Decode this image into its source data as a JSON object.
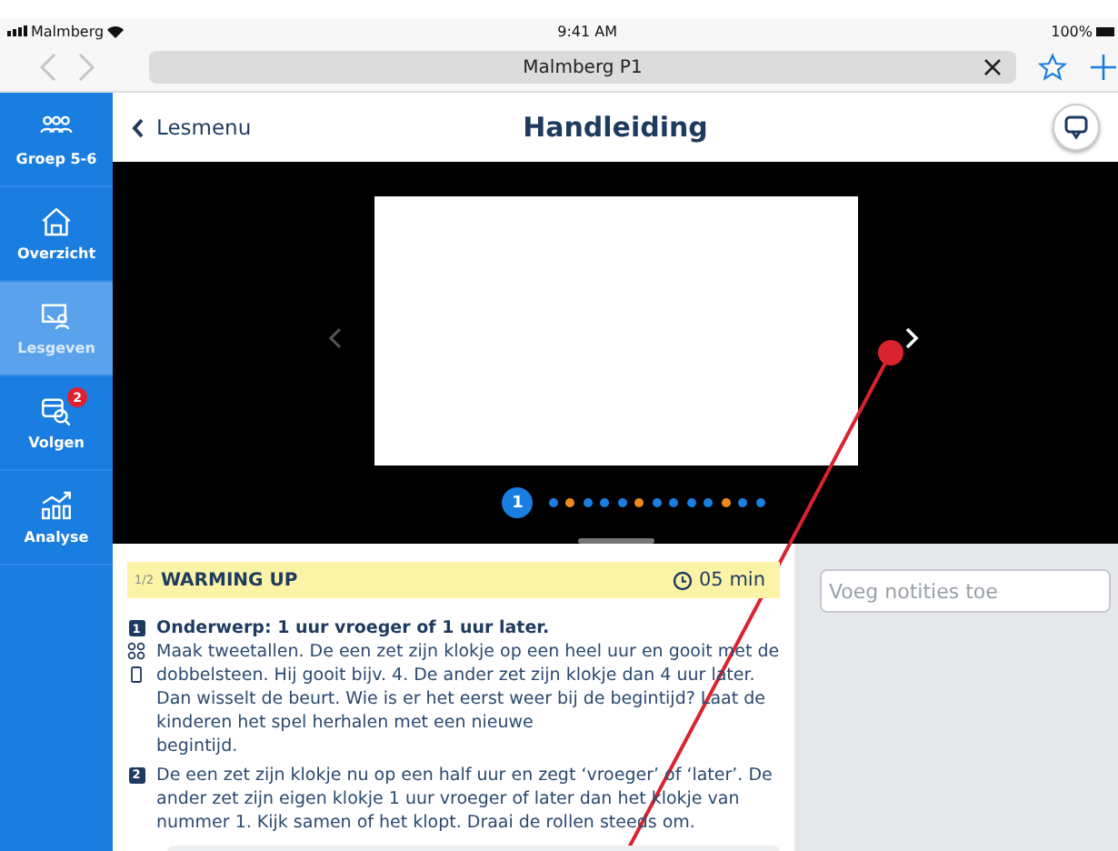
{
  "status_bar": {
    "carrier": "Malmberg",
    "time": "9:41 AM",
    "battery": "100%"
  },
  "browser": {
    "address": "Malmberg P1"
  },
  "sidebar": {
    "items": [
      {
        "label": "Groep 5-6",
        "selected": false
      },
      {
        "label": "Overzicht",
        "selected": false
      },
      {
        "label": "Lesgeven",
        "selected": true
      },
      {
        "label": "Volgen",
        "selected": false,
        "badge": "2"
      },
      {
        "label": "Analyse",
        "selected": false
      }
    ]
  },
  "header": {
    "back": "Lesmenu",
    "title": "Handleiding"
  },
  "slide_indicator": {
    "current": "1",
    "dots": [
      {
        "color": "#1a7de0"
      },
      {
        "color": "#f08a1c"
      },
      {
        "color": "#1a7de0"
      },
      {
        "color": "#1a7de0"
      },
      {
        "color": "#1a7de0"
      },
      {
        "color": "#f08a1c"
      },
      {
        "color": "#1a7de0"
      },
      {
        "color": "#1a7de0"
      },
      {
        "color": "#1a7de0"
      },
      {
        "color": "#1a7de0"
      },
      {
        "color": "#f08a1c"
      },
      {
        "color": "#1a7de0"
      },
      {
        "color": "#1a7de0"
      }
    ]
  },
  "section": {
    "step": "1/2",
    "title": "WARMING UP",
    "duration": "05 min"
  },
  "steps": [
    {
      "number": "1",
      "title": "Onderwerp: 1 uur vroeger of 1 uur later.",
      "body": "Maak tweetallen. De een zet zijn klokje op een heel uur en gooit met de dobbelsteen. Hij gooit bijv. 4. De ander zet zijn klokje dan 4 uur later. Dan wisselt de beurt. Wie is er het eerst weer bij de begintijd? Laat de kinderen het spel herhalen met een nieuwe\nbegintijd."
    },
    {
      "number": "2",
      "body": "De een zet zijn klokje nu op een half uur en zegt ‘vroeger’ of ‘later’. De ander zet zijn eigen klokje 1 uur vroeger of later dan het klokje van nummer 1. Kijk samen of het klopt. Draai de rollen steeds om."
    }
  ],
  "notes": {
    "placeholder": "Voeg notities toe"
  }
}
